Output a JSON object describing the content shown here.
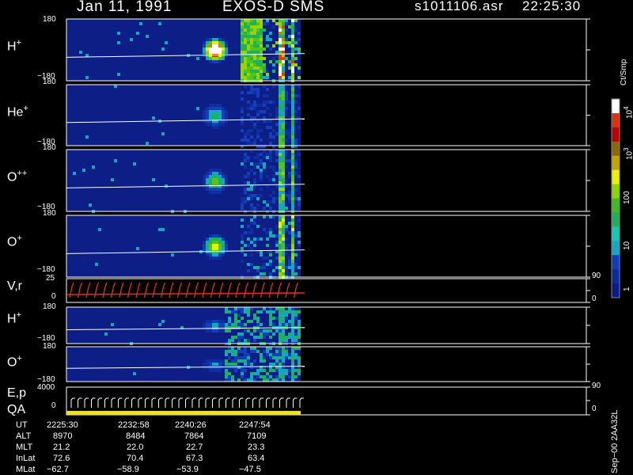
{
  "header": {
    "date": "Jan 11, 1991",
    "instrument": "EXOS-D SMS",
    "file": "s1011106.asr",
    "time": "22:25:30"
  },
  "colors": {
    "frame": "#ffffff",
    "background": "#000000",
    "deep_blue": "#0d1f86",
    "trace_red": "#e0301e",
    "qa_yellow": "#f4e200"
  },
  "chart_data": [
    {
      "type": "heatmap",
      "panels": [
        {
          "label_base": "H",
          "label_sup": "+",
          "ytop": "180",
          "ybottom": "−180"
        },
        {
          "label_base": "He",
          "label_sup": "+",
          "ytop": "180",
          "ybottom": "−180"
        },
        {
          "label_base": "O",
          "label_sup": "++",
          "ytop": "180",
          "ybottom": "−180"
        },
        {
          "label_base": "O",
          "label_sup": "+",
          "ytop": "180",
          "ybottom": "−180"
        }
      ],
      "colorbar": {
        "unit": "Ct/Smp",
        "ticks": [
          "1",
          "10",
          "100",
          "10",
          "10"
        ],
        "tick_exponents": [
          "",
          "",
          "",
          "3",
          "4"
        ],
        "tick_values": [
          1,
          10,
          100,
          1000,
          10000
        ],
        "scale": "log"
      }
    },
    {
      "type": "line",
      "label": "V,r",
      "yticks_left": [
        "25",
        "0"
      ],
      "yticks_right": [
        "90",
        "0"
      ]
    },
    {
      "type": "heatmap",
      "panels": [
        {
          "label_base": "H",
          "label_sup": "+",
          "ytop": "180",
          "ybottom": "−180"
        },
        {
          "label_base": "O",
          "label_sup": "+",
          "ytop": "180",
          "ybottom": "−180"
        }
      ]
    },
    {
      "type": "line",
      "label": "E,p",
      "label2": "QA",
      "yticks_left": [
        "4000",
        "0"
      ],
      "yticks_right": [
        "90",
        "0"
      ]
    }
  ],
  "ephemeris": {
    "rows": [
      {
        "name": "UT",
        "values": [
          "2225:30",
          "2232:58",
          "2240:26",
          "2247:54"
        ]
      },
      {
        "name": "ALT",
        "values": [
          "8970",
          "8484",
          "7864",
          "7109"
        ]
      },
      {
        "name": "MLT",
        "values": [
          "21.2",
          "22.0",
          "22.7",
          "23.3"
        ]
      },
      {
        "name": "InLat",
        "values": [
          "72.6",
          "70.4",
          "67.3",
          "63.4"
        ]
      },
      {
        "name": "MLat",
        "values": [
          "−62.7",
          "−58.9",
          "−53.9",
          "−47.5"
        ]
      }
    ]
  },
  "footer": {
    "version": "Sep−00 2AA32L"
  }
}
